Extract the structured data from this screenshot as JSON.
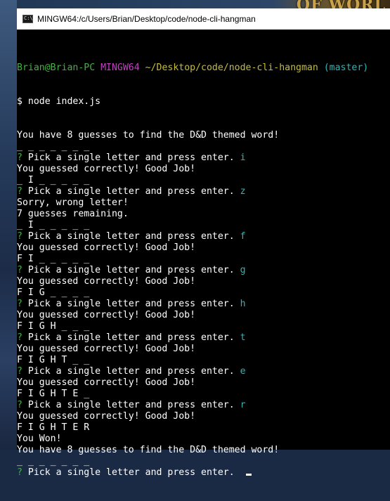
{
  "wallpaper": {
    "logo_text": "OF WORL"
  },
  "window": {
    "title": "MINGW64:/c/Users/Brian/Desktop/code/node-cli-hangman",
    "icon": "terminal-icon",
    "icon_glyph": "C:\\"
  },
  "terminal": {
    "prompt": {
      "user_host": "Brian@Brian-PC",
      "shell": "MINGW64",
      "path": "~/Desktop/code/node-cli-hangman",
      "branch": "(master)"
    },
    "command": "$ node index.js",
    "question_mark": "?",
    "question": "Pick a single letter and press enter.",
    "lines": [
      {
        "type": "text",
        "text": "You have 8 guesses to find the D&D themed word!"
      },
      {
        "type": "text",
        "text": "_ _ _ _ _ _ _"
      },
      {
        "type": "question",
        "answer": "i"
      },
      {
        "type": "text",
        "text": "You guessed correctly! Good Job!"
      },
      {
        "type": "text",
        "text": "_ I _ _ _ _ _"
      },
      {
        "type": "question",
        "answer": "z"
      },
      {
        "type": "text",
        "text": "Sorry, wrong letter!"
      },
      {
        "type": "text",
        "text": "7 guesses remaining."
      },
      {
        "type": "text",
        "text": "_ I _ _ _ _ _"
      },
      {
        "type": "question",
        "answer": "f"
      },
      {
        "type": "text",
        "text": "You guessed correctly! Good Job!"
      },
      {
        "type": "text",
        "text": "F I _ _ _ _ _"
      },
      {
        "type": "question",
        "answer": "g"
      },
      {
        "type": "text",
        "text": "You guessed correctly! Good Job!"
      },
      {
        "type": "text",
        "text": "F I G _ _ _ _"
      },
      {
        "type": "question",
        "answer": "h"
      },
      {
        "type": "text",
        "text": "You guessed correctly! Good Job!"
      },
      {
        "type": "text",
        "text": "F I G H _ _ _"
      },
      {
        "type": "question",
        "answer": "t"
      },
      {
        "type": "text",
        "text": "You guessed correctly! Good Job!"
      },
      {
        "type": "text",
        "text": "F I G H T _ _"
      },
      {
        "type": "question",
        "answer": "e"
      },
      {
        "type": "text",
        "text": "You guessed correctly! Good Job!"
      },
      {
        "type": "text",
        "text": "F I G H T E _"
      },
      {
        "type": "question",
        "answer": "r"
      },
      {
        "type": "text",
        "text": "You guessed correctly! Good Job!"
      },
      {
        "type": "text",
        "text": "F I G H T E R"
      },
      {
        "type": "text",
        "text": "You Won!"
      },
      {
        "type": "text",
        "text": "You have 8 guesses to find the D&D themed word!"
      },
      {
        "type": "text",
        "text": "_ _ _ _ _ _ _"
      },
      {
        "type": "question-active",
        "answer": ""
      }
    ]
  },
  "colors": {
    "background": "#000000",
    "text": "#ffffff",
    "user_host": "#3db53d",
    "shell": "#c43fc4",
    "path": "#c4bd3a",
    "branch": "#2fb5b5",
    "question_mark": "#3db53d",
    "answer": "#2fb5b5"
  }
}
